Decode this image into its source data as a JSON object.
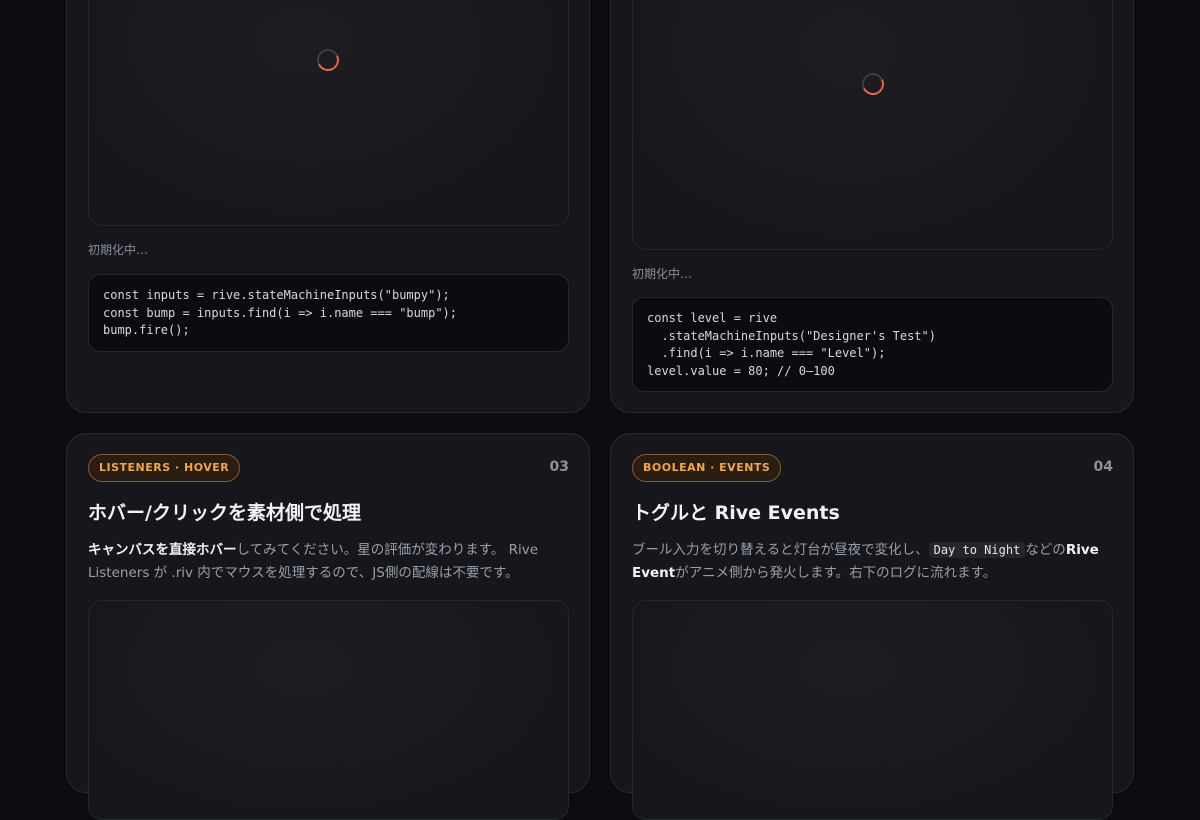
{
  "cards": [
    {
      "status": "初期化中…",
      "code": "const inputs = rive.stateMachineInputs(\"bumpy\");\nconst bump = inputs.find(i => i.name === \"bump\");\nbump.fire();"
    },
    {
      "status": "初期化中…",
      "code": "const level = rive\n  .stateMachineInputs(\"Designer's Test\")\n  .find(i => i.name === \"Level\");\nlevel.value = 80; // 0–100"
    },
    {
      "badge": "LISTENERS · HOVER",
      "number": "03",
      "title": "ホバー/クリックを素材側で処理",
      "desc": {
        "strong": "キャンバスを直接ホバー",
        "rest": "してみてください。星の評価が変わります。 Rive Listeners が .riv 内でマウスを処理するので、JS側の配線は不要です。"
      }
    },
    {
      "badge": "BOOLEAN · EVENTS",
      "number": "04",
      "title": "トグルと Rive Events",
      "desc": {
        "pre": "ブール入力を切り替えると灯台が昼夜で変化し、",
        "code": "Day to Night",
        "mid": "などの",
        "strong": "Rive Event",
        "post": "がアニメ側から発火します。右下のログに流れます。"
      }
    }
  ],
  "colors": {
    "background": "#0c0d11",
    "card": "#15171c",
    "badge_text": "#f2a646",
    "spinner_accent": "#f0623f"
  }
}
